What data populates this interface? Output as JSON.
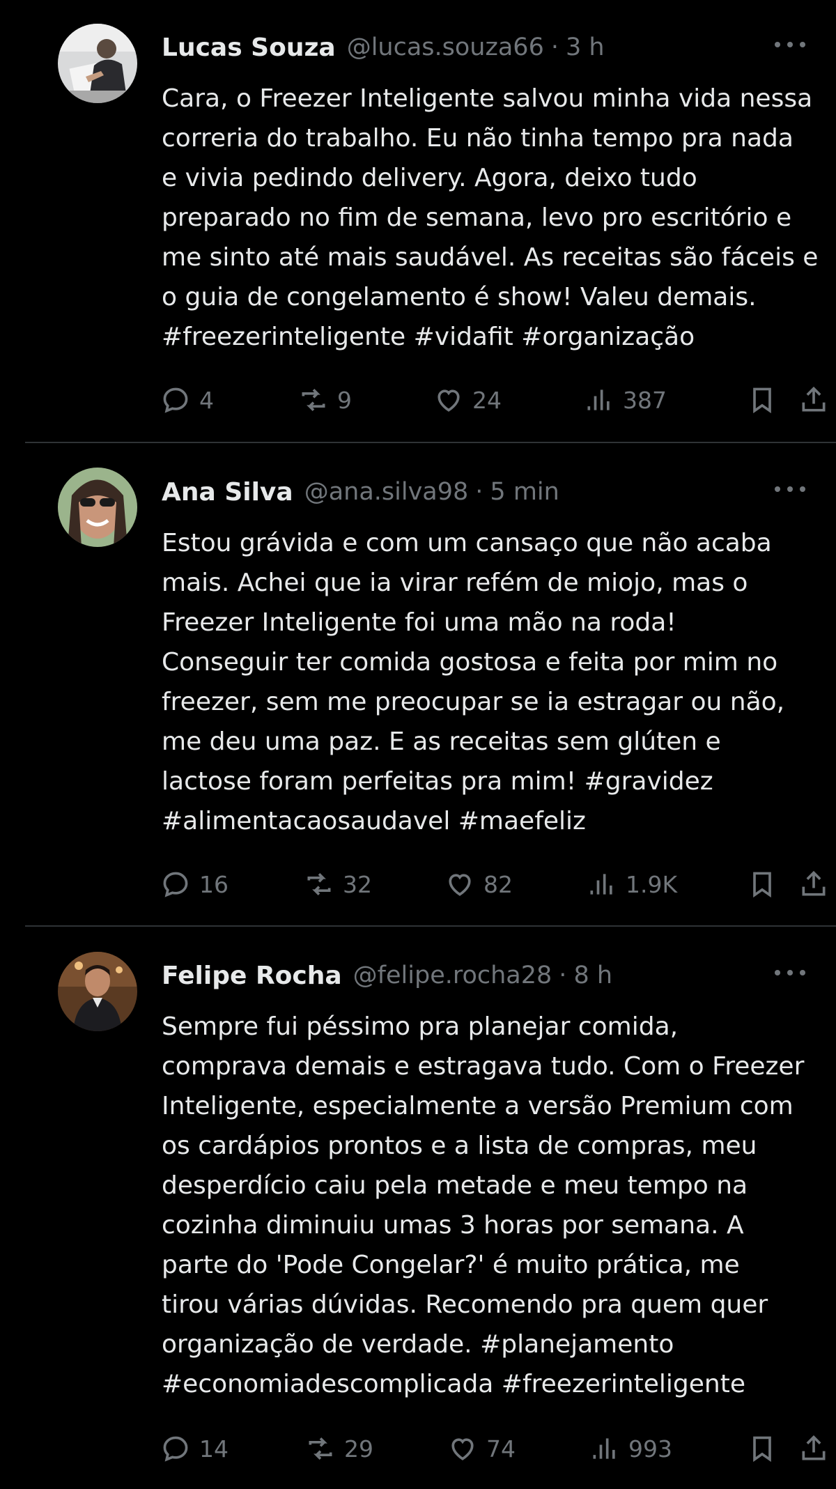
{
  "tweets": [
    {
      "name": "Lucas Souza",
      "handle": "@lucas.souza66",
      "separator": "·",
      "time": "3 h",
      "text": "Cara, o Freezer Inteligente salvou minha vida nessa\ncorreria do trabalho. Eu não tinha tempo pra nada\ne vivia pedindo delivery. Agora, deixo tudo\npreparado no fim de semana, levo pro escritório e\nme sinto até mais saudável. As receitas são fáceis e\no guia de congelamento é show! Valeu demais.\n#freezerinteligente #vidafit #organização",
      "replies": "4",
      "reposts": "9",
      "likes": "24",
      "views": "387"
    },
    {
      "name": "Ana Silva",
      "handle": "@ana.silva98",
      "separator": "·",
      "time": "5 min",
      "text": "Estou grávida e com um cansaço que não acaba\nmais. Achei que ia virar refém de miojo, mas o\nFreezer Inteligente foi uma mão na roda!\nConseguir ter comida gostosa e feita por mim no\nfreezer, sem me preocupar se ia estragar ou não,\nme deu uma paz. E as receitas sem glúten e\nlactose foram perfeitas pra mim! #gravidez\n#alimentacaosaudavel #maefeliz",
      "replies": "16",
      "reposts": "32",
      "likes": "82",
      "views": "1.9K"
    },
    {
      "name": "Felipe Rocha",
      "handle": "@felipe.rocha28",
      "separator": "·",
      "time": "8 h",
      "text": "Sempre fui péssimo pra planejar comida,\ncomprava demais e estragava tudo. Com o Freezer\nInteligente, especialmente a versão Premium com\nos cardápios prontos e a lista de compras, meu\ndesperdício caiu pela metade e meu tempo na\ncozinha diminuiu umas 3 horas por semana. A\nparte do 'Pode Congelar?' é muito prática, me\ntirou várias dúvidas. Recomendo pra quem quer\norganização de verdade. #planejamento\n#economiadescomplicada #freezerinteligente",
      "replies": "14",
      "reposts": "29",
      "likes": "74",
      "views": "993"
    }
  ],
  "icons": {
    "reply": "reply-icon",
    "repost": "repost-icon",
    "like": "like-icon",
    "views": "views-icon",
    "bookmark": "bookmark-icon",
    "share": "share-icon",
    "more": "more-icon"
  },
  "colors": {
    "background": "#000000",
    "text": "#e7e9ea",
    "muted": "#71767b",
    "divider": "#2f3336"
  }
}
